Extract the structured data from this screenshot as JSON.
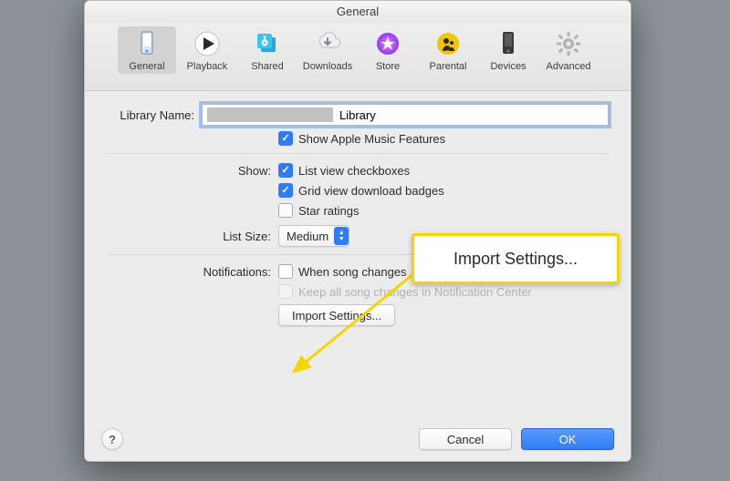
{
  "window": {
    "title": "General"
  },
  "toolbar": {
    "items": [
      {
        "label": "General"
      },
      {
        "label": "Playback"
      },
      {
        "label": "Shared"
      },
      {
        "label": "Downloads"
      },
      {
        "label": "Store"
      },
      {
        "label": "Parental"
      },
      {
        "label": "Devices"
      },
      {
        "label": "Advanced"
      }
    ]
  },
  "library": {
    "label": "Library Name:",
    "value": "Library",
    "show_apple_music": "Show Apple Music Features"
  },
  "show": {
    "label": "Show:",
    "list_view_checkboxes": "List view checkboxes",
    "grid_view_badges": "Grid view download badges",
    "star_ratings": "Star ratings"
  },
  "list_size": {
    "label": "List Size:",
    "value": "Medium"
  },
  "notifications": {
    "label": "Notifications:",
    "when_song_changes": "When song changes",
    "keep_all": "Keep all song changes in Notification Center"
  },
  "buttons": {
    "import_settings": "Import Settings...",
    "cancel": "Cancel",
    "ok": "OK",
    "help": "?"
  },
  "callout": {
    "text": "Import Settings..."
  }
}
